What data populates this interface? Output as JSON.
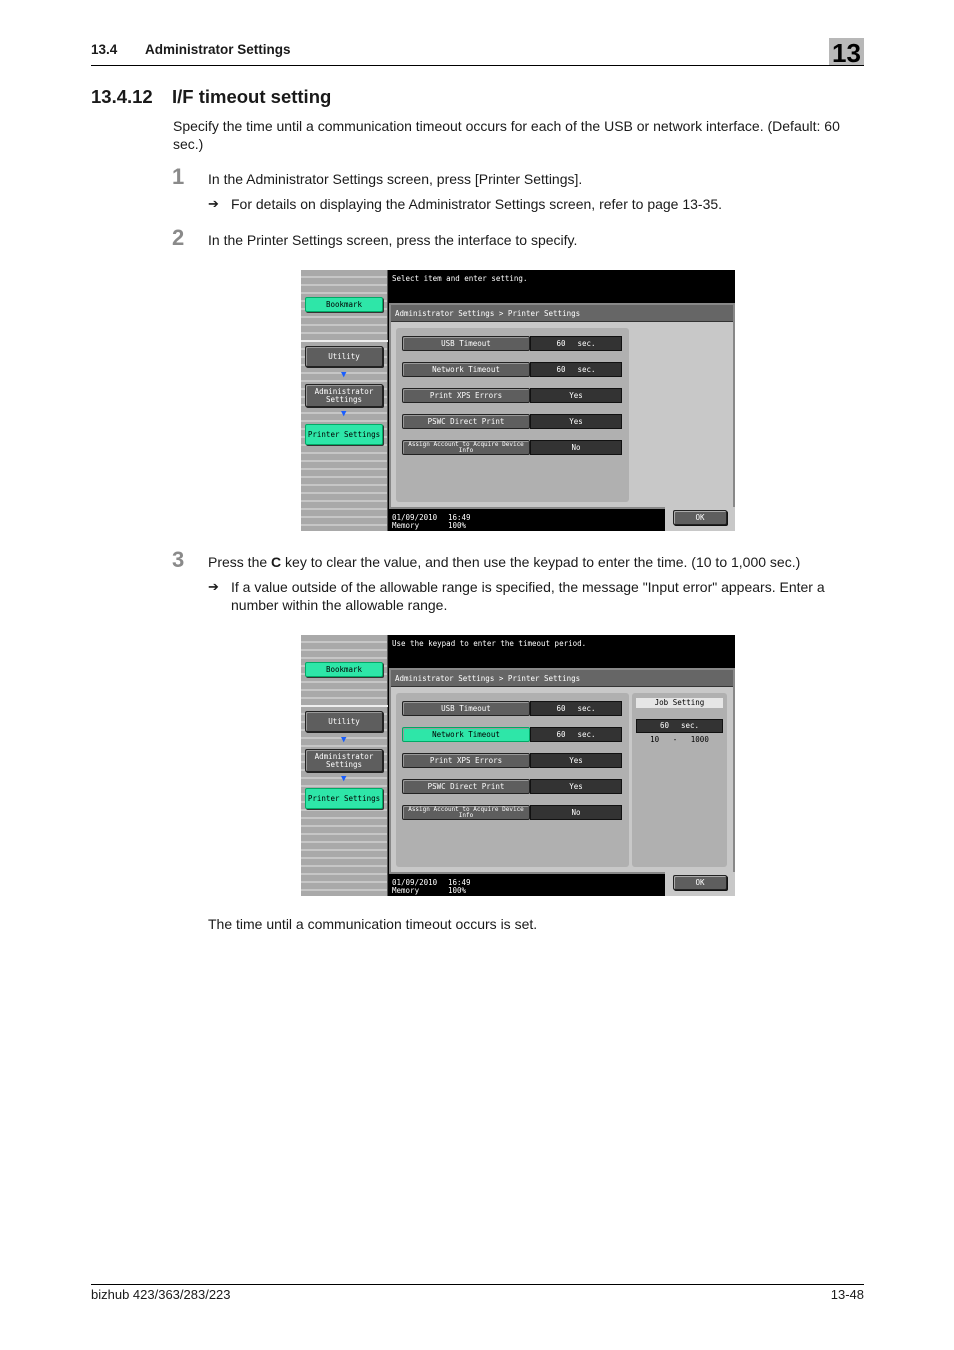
{
  "header": {
    "section_number": "13.4",
    "section_title": "Administrator Settings",
    "chapter": "13"
  },
  "title": {
    "number": "13.4.12",
    "text": "I/F timeout setting"
  },
  "intro": "Specify the time until a communication timeout occurs for each of the USB or network interface. (Default: 60 sec.)",
  "steps": [
    {
      "number": "1",
      "text": "In the Administrator Settings screen, press [Printer Settings].",
      "note": "For details on displaying the Administrator Settings screen, refer to page 13-35."
    },
    {
      "number": "2",
      "text": "In the Printer Settings screen, press the interface to specify."
    },
    {
      "number": "3",
      "text_before": "Press the ",
      "text_bold": "C",
      "text_after": " key to clear the value, and then use the keypad to enter the time. (10 to 1,000 sec.)",
      "note": "If a value outside of the allowable range is specified, the message \"Input error\" appears. Enter a number within the allowable range."
    }
  ],
  "arrow_glyph": "➔",
  "screen1": {
    "message": "Select item and enter setting.",
    "bookmark": "Bookmark",
    "nav": [
      "Utility",
      "Administrator Settings",
      "Printer Settings"
    ],
    "breadcrumb": "Administrator Settings > Printer Settings",
    "rows": [
      {
        "label": "USB Timeout",
        "value": "60",
        "unit": "sec."
      },
      {
        "label": "Network Timeout",
        "value": "60",
        "unit": "sec."
      },
      {
        "label": "Print XPS Errors",
        "value": "Yes",
        "unit": ""
      },
      {
        "label": "PSWC Direct Print",
        "value": "Yes",
        "unit": ""
      },
      {
        "label": "Assign Account to Acquire Device Info",
        "value": "No",
        "unit": ""
      }
    ],
    "date": "01/09/2010",
    "time": "16:49",
    "memory_label": "Memory",
    "memory_value": "100%",
    "ok": "OK"
  },
  "screen2": {
    "message": "Use the keypad to enter the timeout period.",
    "bookmark": "Bookmark",
    "nav": [
      "Utility",
      "Administrator Settings",
      "Printer Settings"
    ],
    "breadcrumb": "Administrator Settings > Printer Settings",
    "rows": [
      {
        "label": "USB Timeout",
        "value": "60",
        "unit": "sec."
      },
      {
        "label": "Network Timeout",
        "value": "60",
        "unit": "sec."
      },
      {
        "label": "Print XPS Errors",
        "value": "Yes",
        "unit": ""
      },
      {
        "label": "PSWC Direct Print",
        "value": "Yes",
        "unit": ""
      },
      {
        "label": "Assign Account to Acquire Device Info",
        "value": "No",
        "unit": ""
      }
    ],
    "active_row": "Network Timeout",
    "job_setting": {
      "title": "Job Setting",
      "value": "60",
      "unit": "sec.",
      "range_min": "10",
      "range_sep": "-",
      "range_max": "1000"
    },
    "date": "01/09/2010",
    "time": "16:49",
    "memory_label": "Memory",
    "memory_value": "100%",
    "ok": "OK"
  },
  "result": "The time until a communication timeout occurs is set.",
  "footer": {
    "model": "bizhub 423/363/283/223",
    "page": "13-48"
  },
  "colors": {
    "highlight": "#2ee6a8",
    "step_number": "#8a8a8a",
    "chapter_box": "#b8b8b8"
  }
}
